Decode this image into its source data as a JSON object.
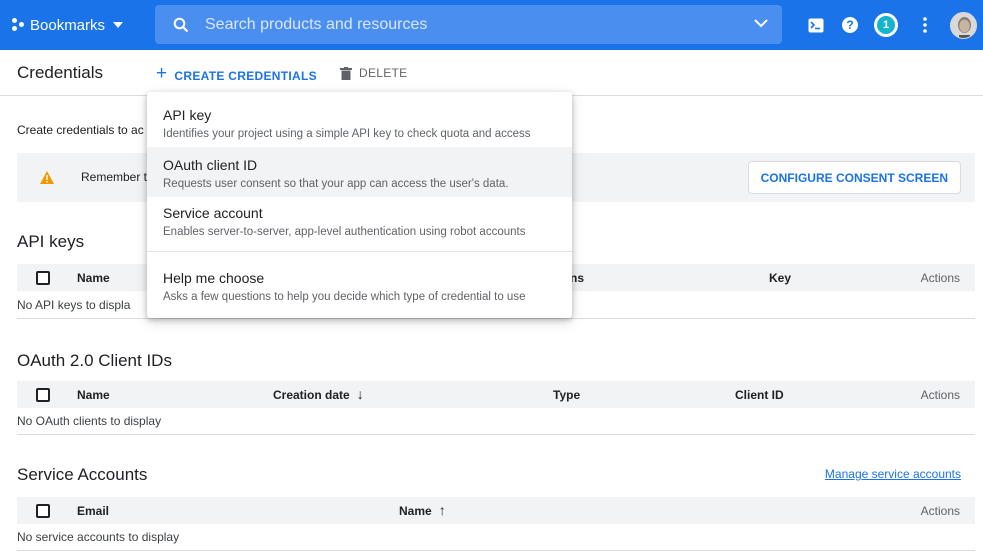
{
  "topbar": {
    "project_name": "Bookmarks",
    "search_placeholder": "Search products and resources",
    "notification_count": "1"
  },
  "actionbar": {
    "title": "Credentials",
    "create_label": "CREATE CREDENTIALS",
    "delete_label": "DELETE"
  },
  "intro_text": "Create credentials to ac",
  "banner": {
    "text": "Remember t",
    "button_label": "CONFIGURE CONSENT SCREEN"
  },
  "api_keys": {
    "title": "API keys",
    "columns": [
      "Name",
      "ns",
      "Key",
      "Actions"
    ],
    "empty_text": "No API keys to displa"
  },
  "oauth": {
    "title": "OAuth 2.0 Client IDs",
    "columns": [
      "Name",
      "Creation date",
      "Type",
      "Client ID",
      "Actions"
    ],
    "empty_text": "No OAuth clients to display"
  },
  "service_accounts": {
    "title": "Service Accounts",
    "manage_link": "Manage service accounts",
    "columns": [
      "Email",
      "Name",
      "Actions"
    ],
    "empty_text": "No service accounts to display"
  },
  "menu": {
    "items": [
      {
        "title": "API key",
        "description": "Identifies your project using a simple API key to check quota and access"
      },
      {
        "title": "OAuth client ID",
        "description": "Requests user consent so that your app can access the user's data."
      },
      {
        "title": "Service account",
        "description": "Enables server-to-server, app-level authentication using robot accounts"
      },
      {
        "title": "Help me choose",
        "description": "Asks a few questions to help you decide which type of credential to use"
      }
    ]
  },
  "colors": {
    "brand_blue": "#1a73e8",
    "warning_orange": "#f29900",
    "header_gray": "#f1f3f4"
  }
}
